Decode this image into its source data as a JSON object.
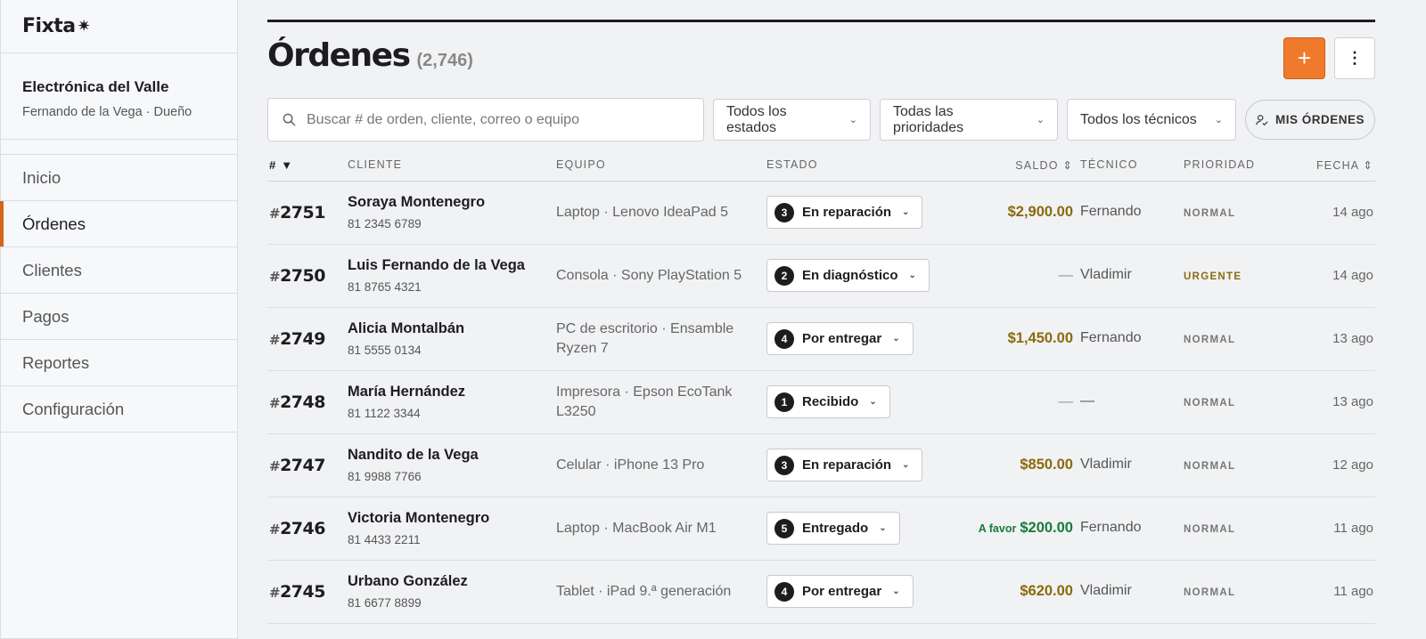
{
  "brand": {
    "logo_text": "Fixta",
    "logo_star": "✷"
  },
  "business": {
    "name": "Electrónica del Valle",
    "user": "Fernando de la Vega · Dueño"
  },
  "nav": [
    {
      "label": "Inicio",
      "active": false
    },
    {
      "label": "Órdenes",
      "active": true
    },
    {
      "label": "Clientes",
      "active": false
    },
    {
      "label": "Pagos",
      "active": false
    },
    {
      "label": "Reportes",
      "active": false
    },
    {
      "label": "Configuración",
      "active": false
    }
  ],
  "header": {
    "title": "Órdenes",
    "count": "(2,746)",
    "add_icon": "+",
    "more_icon": "⋮"
  },
  "search": {
    "placeholder": "Buscar # de orden, cliente, correo o equipo",
    "value": ""
  },
  "filters": {
    "estado": "Todos los estados",
    "prioridad": "Todas las prioridades",
    "tecnico": "Todos los técnicos",
    "mis_ordenes": "MIS ÓRDENES"
  },
  "table": {
    "headers": {
      "num": "# ▼",
      "cliente": "CLIENTE",
      "equipo": "EQUIPO",
      "estado": "ESTADO",
      "saldo": "SALDO ⇕",
      "tecnico": "TÉCNICO",
      "prioridad": "PRIORIDAD",
      "fecha": "FECHA ⇕"
    },
    "rows": [
      {
        "num": "2751",
        "client": "Soraya Montenegro",
        "phone": "81 2345 6789",
        "equip": "Laptop · Lenovo IdeaPad 5",
        "step": "3",
        "status": "En reparación",
        "saldo_prefix": "",
        "saldo": "$2,900.00",
        "saldo_kind": "due",
        "tech": "Fernando",
        "prio": "NORMAL",
        "prio_kind": "normal",
        "date": "14 ago"
      },
      {
        "num": "2750",
        "client": "Luis Fernando de la Vega",
        "phone": "81 8765 4321",
        "equip": "Consola · Sony PlayStation 5",
        "step": "2",
        "status": "En diagnóstico",
        "saldo_prefix": "",
        "saldo": "—",
        "saldo_kind": "none",
        "tech": "Vladimir",
        "prio": "URGENTE",
        "prio_kind": "urgent",
        "date": "14 ago"
      },
      {
        "num": "2749",
        "client": "Alicia Montalbán",
        "phone": "81 5555 0134",
        "equip": "PC de escritorio · Ensamble Ryzen 7",
        "step": "4",
        "status": "Por entregar",
        "saldo_prefix": "",
        "saldo": "$1,450.00",
        "saldo_kind": "due",
        "tech": "Fernando",
        "prio": "NORMAL",
        "prio_kind": "normal",
        "date": "13 ago"
      },
      {
        "num": "2748",
        "client": "María Hernández",
        "phone": "81 1122 3344",
        "equip": "Impresora · Epson EcoTank L3250",
        "step": "1",
        "status": "Recibido",
        "saldo_prefix": "",
        "saldo": "—",
        "saldo_kind": "none",
        "tech": "—",
        "prio": "NORMAL",
        "prio_kind": "normal",
        "date": "13 ago"
      },
      {
        "num": "2747",
        "client": "Nandito de la Vega",
        "phone": "81 9988 7766",
        "equip": "Celular · iPhone 13 Pro",
        "step": "3",
        "status": "En reparación",
        "saldo_prefix": "",
        "saldo": "$850.00",
        "saldo_kind": "due",
        "tech": "Vladimir",
        "prio": "NORMAL",
        "prio_kind": "normal",
        "date": "12 ago"
      },
      {
        "num": "2746",
        "client": "Victoria Montenegro",
        "phone": "81 4433 2211",
        "equip": "Laptop · MacBook Air M1",
        "step": "5",
        "status": "Entregado",
        "saldo_prefix": "A favor",
        "saldo": "$200.00",
        "saldo_kind": "favor",
        "tech": "Fernando",
        "prio": "NORMAL",
        "prio_kind": "normal",
        "date": "11 ago"
      },
      {
        "num": "2745",
        "client": "Urbano González",
        "phone": "81 6677 8899",
        "equip": "Tablet · iPad 9.ª generación",
        "step": "4",
        "status": "Por entregar",
        "saldo_prefix": "",
        "saldo": "$620.00",
        "saldo_kind": "due",
        "tech": "Vladimir",
        "prio": "NORMAL",
        "prio_kind": "normal",
        "date": "11 ago"
      }
    ]
  },
  "colors": {
    "accent": "#f07a2c",
    "nav_active": "#d1661c",
    "saldo_due": "#8a6a0d",
    "saldo_favor": "#1a7a3a"
  },
  "icons": {
    "search": "search-icon",
    "chevron": "chevron-down-icon",
    "user_check": "user-check-icon",
    "more": "more-vertical-icon",
    "add": "plus-icon"
  }
}
